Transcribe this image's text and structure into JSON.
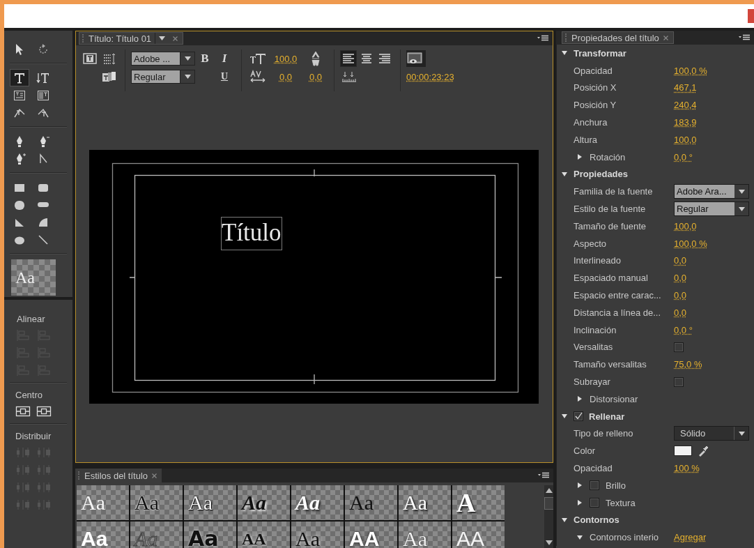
{
  "tools": [
    {
      "kind": "select",
      "selected": false
    },
    {
      "kind": "rotate",
      "selected": false
    },
    {
      "kind": "type",
      "selected": true
    },
    {
      "kind": "vtype",
      "selected": false
    },
    {
      "kind": "area-type",
      "selected": false
    },
    {
      "kind": "varea-type",
      "selected": false
    },
    {
      "kind": "path-type",
      "selected": false
    },
    {
      "kind": "vpath-type",
      "selected": false
    },
    {
      "kind": "pen",
      "selected": false
    },
    {
      "kind": "pen-minus",
      "selected": false
    },
    {
      "kind": "pen-plus",
      "selected": false
    },
    {
      "kind": "convert",
      "selected": false
    },
    {
      "kind": "rect",
      "selected": false
    },
    {
      "kind": "rounded-rect",
      "selected": false
    },
    {
      "kind": "circle-rect",
      "selected": false
    },
    {
      "kind": "pill",
      "selected": false
    },
    {
      "kind": "wedge",
      "selected": false
    },
    {
      "kind": "arc",
      "selected": false
    },
    {
      "kind": "ellipse",
      "selected": false
    },
    {
      "kind": "line",
      "selected": false
    }
  ],
  "style_preview": {
    "sample": "Aa"
  },
  "align_panel": {
    "sections": [
      {
        "label": "Alinear",
        "buttons": [
          {
            "kind": "align",
            "disabled": true
          },
          {
            "kind": "align",
            "disabled": true
          },
          {
            "kind": "align",
            "disabled": true
          },
          {
            "kind": "align",
            "disabled": true
          },
          {
            "kind": "align",
            "disabled": true
          },
          {
            "kind": "align",
            "disabled": true
          }
        ]
      },
      {
        "label": "Centro",
        "buttons": [
          {
            "kind": "center",
            "disabled": false
          },
          {
            "kind": "center",
            "disabled": false
          }
        ]
      },
      {
        "label": "Distribuir",
        "buttons": [
          {
            "kind": "distribute",
            "disabled": true
          },
          {
            "kind": "distribute",
            "disabled": true
          },
          {
            "kind": "distribute",
            "disabled": true
          },
          {
            "kind": "distribute",
            "disabled": true
          },
          {
            "kind": "distribute",
            "disabled": true
          },
          {
            "kind": "distribute",
            "disabled": true
          },
          {
            "kind": "distribute",
            "disabled": true
          },
          {
            "kind": "distribute",
            "disabled": true
          }
        ]
      }
    ]
  },
  "title_panel": {
    "tab": "Título: Título 01",
    "toolbar": {
      "font_family": "Adobe ...",
      "font_style": "Regular",
      "bold": "B",
      "italic": "I",
      "underline": "U",
      "font_size": "100,0",
      "kerning": "0,0",
      "tracking": "0,0",
      "alignment": [
        {
          "kind": "left",
          "selected": true
        },
        {
          "kind": "center",
          "selected": false
        },
        {
          "kind": "right",
          "selected": false
        }
      ],
      "timecode": "00:00:23:23"
    },
    "canvas": {
      "text": "Título"
    }
  },
  "styles_panel": {
    "tab": "Estilos del título",
    "swatches": [
      {
        "sample": "Aa",
        "kind": "plain"
      },
      {
        "sample": "Aa",
        "kind": "dark-outline"
      },
      {
        "sample": "Aa",
        "kind": "light-outline"
      },
      {
        "sample": "Aa",
        "kind": "dark-script"
      },
      {
        "sample": "Aa",
        "kind": "light-script"
      },
      {
        "sample": "Aa",
        "kind": "dark"
      },
      {
        "sample": "Aa",
        "kind": "light-shadow"
      },
      {
        "sample": "A",
        "kind": "slab"
      },
      {
        "sample": "Aa",
        "kind": "light-bold"
      },
      {
        "sample": "Aa",
        "kind": "outline-script"
      },
      {
        "sample": "Aa",
        "kind": "dark-heavy"
      },
      {
        "sample": "AA",
        "kind": "dark-condensed"
      },
      {
        "sample": "Aa",
        "kind": "dark-glow"
      },
      {
        "sample": "AA",
        "kind": "light-heavy"
      },
      {
        "sample": "Aa",
        "kind": "light-thin"
      },
      {
        "sample": "AA",
        "kind": "thin"
      }
    ]
  },
  "properties_panel": {
    "tab": "Propiedades del título",
    "rows": [
      {
        "kind": "section",
        "label": "Transformar",
        "expanded": true
      },
      {
        "kind": "value",
        "label": "Opacidad",
        "value": "100,0 %"
      },
      {
        "kind": "value",
        "label": "Posición X",
        "value": "467,1"
      },
      {
        "kind": "value",
        "label": "Posición Y",
        "value": "240,4"
      },
      {
        "kind": "value",
        "label": "Anchura",
        "value": "183,9"
      },
      {
        "kind": "value",
        "label": "Altura",
        "value": "100,0"
      },
      {
        "kind": "group",
        "label": "Rotación",
        "expanded": false,
        "value": "0,0 °"
      },
      {
        "kind": "section",
        "label": "Propiedades",
        "expanded": true
      },
      {
        "kind": "dropdown",
        "label": "Familia de la fuente",
        "value": "Adobe Ara..."
      },
      {
        "kind": "dropdown",
        "label": "Estilo de la fuente",
        "value": "Regular"
      },
      {
        "kind": "value",
        "label": "Tamaño de fuente",
        "value": "100,0"
      },
      {
        "kind": "value",
        "label": "Aspecto",
        "value": "100,0 %"
      },
      {
        "kind": "value",
        "label": "Interlineado",
        "value": "0,0"
      },
      {
        "kind": "value",
        "label": "Espaciado manual",
        "value": "0,0"
      },
      {
        "kind": "value",
        "label": "Espacio entre carac...",
        "value": "0,0"
      },
      {
        "kind": "value",
        "label": "Distancia a línea de...",
        "value": "0,0"
      },
      {
        "kind": "value",
        "label": "Inclinación",
        "value": "0,0 °"
      },
      {
        "kind": "checkbox",
        "label": "Versalitas",
        "checked": false
      },
      {
        "kind": "value",
        "label": "Tamaño versalitas",
        "value": "75,0 %"
      },
      {
        "kind": "checkbox",
        "label": "Subrayar",
        "checked": false
      },
      {
        "kind": "group",
        "label": "Distorsionar",
        "expanded": false
      },
      {
        "kind": "section",
        "label": "Rellenar",
        "expanded": true,
        "checked": true
      },
      {
        "kind": "menu",
        "label": "Tipo de relleno",
        "value": "Sólido"
      },
      {
        "kind": "color",
        "label": "Color",
        "color": "#f2f2f2"
      },
      {
        "kind": "value",
        "label": "Opacidad",
        "value": "100 %"
      },
      {
        "kind": "group",
        "label": "Brillo",
        "expanded": false,
        "checked": false
      },
      {
        "kind": "group",
        "label": "Textura",
        "expanded": false,
        "checked": false
      },
      {
        "kind": "section",
        "label": "Contornos",
        "expanded": true
      },
      {
        "kind": "group",
        "label": "Contornos interio",
        "expanded": true,
        "value": "Agregar"
      }
    ]
  }
}
